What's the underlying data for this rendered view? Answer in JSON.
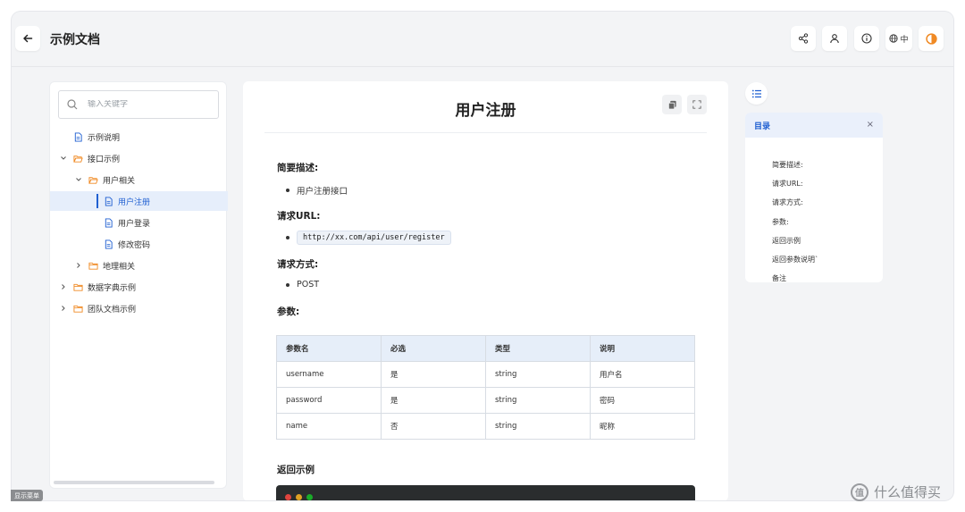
{
  "header": {
    "title": "示例文档",
    "lang_label": "中"
  },
  "sidebar": {
    "search_placeholder": "输入关键字",
    "items": [
      {
        "label": "示例说明"
      },
      {
        "label": "接口示例"
      },
      {
        "label": "用户相关"
      },
      {
        "label": "用户注册"
      },
      {
        "label": "用户登录"
      },
      {
        "label": "修改密码"
      },
      {
        "label": "地理相关"
      },
      {
        "label": "数据字典示例"
      },
      {
        "label": "团队文档示例"
      }
    ]
  },
  "main": {
    "title": "用户注册",
    "sections": {
      "brief_heading": "简要描述:",
      "brief_item": "用户注册接口",
      "url_heading": "请求URL:",
      "url_item": "http://xx.com/api/user/register",
      "method_heading": "请求方式:",
      "method_item": "POST",
      "params_heading": "参数:",
      "return_heading": "返回示例"
    },
    "table": {
      "headers": [
        "参数名",
        "必选",
        "类型",
        "说明"
      ],
      "rows": [
        [
          "username",
          "是",
          "string",
          "用户名"
        ],
        [
          "password",
          "是",
          "string",
          "密码"
        ],
        [
          "name",
          "否",
          "string",
          "昵称"
        ]
      ]
    }
  },
  "toc": {
    "title": "目录",
    "close": "×",
    "items": [
      "简要描述:",
      "请求URL:",
      "请求方式:",
      "参数:",
      "返回示例",
      "返回参数说明`",
      "备注"
    ]
  },
  "status": {
    "menu_hint": "显示菜单"
  },
  "watermark": {
    "icon_text": "值",
    "text": "什么值得买"
  },
  "colors": {
    "accent": "#1f5fd1",
    "folder": "#f08a24",
    "theme_toggle": "#f08a24"
  }
}
